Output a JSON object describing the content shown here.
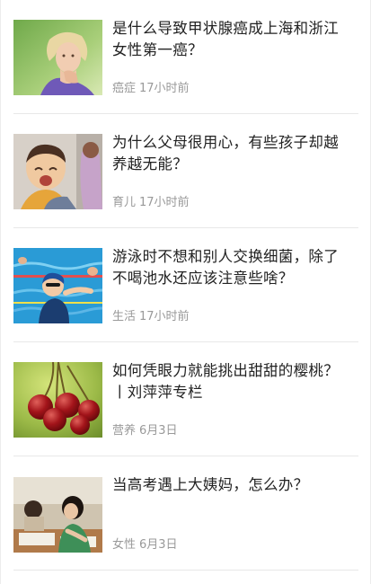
{
  "articles": [
    {
      "title": "是什么导致甲状腺癌成上海和浙江女性第一癌？",
      "tag": "癌症",
      "time": "17小时前",
      "image_icon": "woman-touching-neck-photo"
    },
    {
      "title": "为什么父母很用心，有些孩子却越养越无能？",
      "tag": "育儿",
      "time": "17小时前",
      "image_icon": "crying-child-photo"
    },
    {
      "title": "游泳时不想和别人交换细菌，除了不喝池水还应该注意些啥？",
      "tag": "生活",
      "time": "17小时前",
      "image_icon": "swimming-pool-photo"
    },
    {
      "title": "如何凭眼力就能挑出甜甜的樱桃？丨刘萍萍专栏",
      "tag": "营养",
      "time": "6月3日",
      "image_icon": "cherries-photo"
    },
    {
      "title": "当高考遇上大姨妈，怎么办？",
      "tag": "女性",
      "time": "6月3日",
      "image_icon": "students-exam-photo"
    }
  ]
}
